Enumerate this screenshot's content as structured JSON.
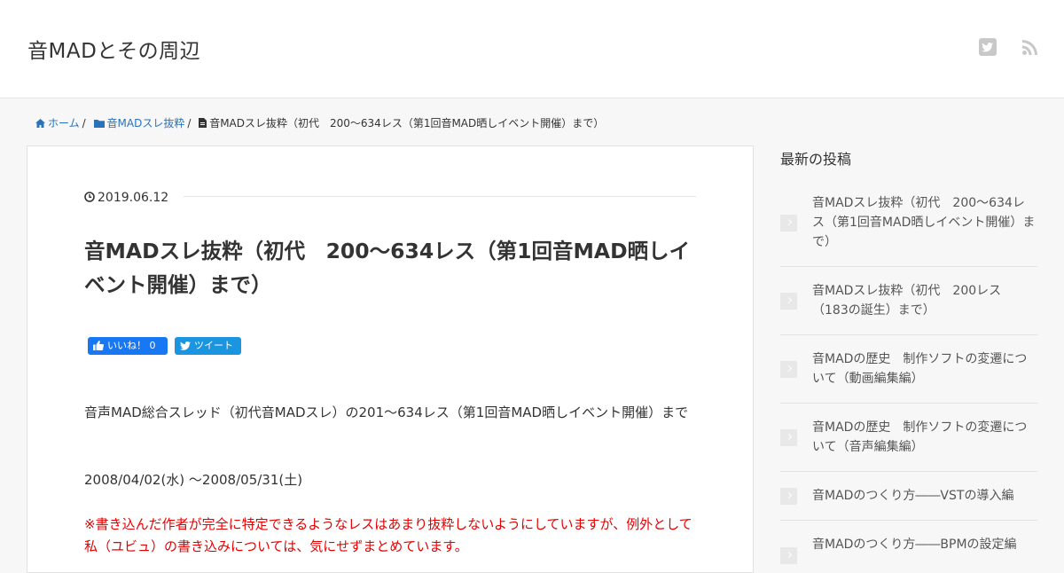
{
  "header": {
    "site_title": "音MADとその周辺",
    "icons": [
      "twitter-icon",
      "rss-icon"
    ]
  },
  "breadcrumb": {
    "home": "ホーム",
    "category": "音MADスレ抜粋",
    "current": "音MADスレ抜粋（初代　200～634レス（第1回音MAD晒しイベント開催）まで）"
  },
  "post": {
    "date": "2019.06.12",
    "title": "音MADスレ抜粋（初代　200～634レス（第1回音MAD晒しイベント開催）まで）",
    "like_label": "いいね！",
    "like_count": "0",
    "tweet_label": "ツイート",
    "paragraph1": "音声MAD総合スレッド（初代音MADスレ）の201～634レス（第1回音MAD晒しイベント開催）まで",
    "paragraph2": "2008/04/02(水) ～2008/05/31(土)",
    "paragraph3": "※書き込んだ作者が完全に特定できるようなレスはあまり抜粋しないようにしていますが、例外として私（ユビュ）の書き込みについては、気にせずまとめています。"
  },
  "sidebar": {
    "heading": "最新の投稿",
    "items": [
      "音MADスレ抜粋（初代　200～634レス（第1回音MAD晒しイベント開催）まで）",
      "音MADスレ抜粋（初代　200レス（183の誕生）まで）",
      "音MADの歴史　制作ソフトの変遷について（動画編集編）",
      "音MADの歴史　制作ソフトの変遷について（音声編集編）",
      "音MADのつくり方――VSTの導入編",
      "音MADのつくり方――BPMの設定編"
    ]
  },
  "colors": {
    "link": "#2b73b8",
    "facebook": "#1877f2",
    "twitter": "#1b95e0",
    "warning": "#e60000"
  }
}
